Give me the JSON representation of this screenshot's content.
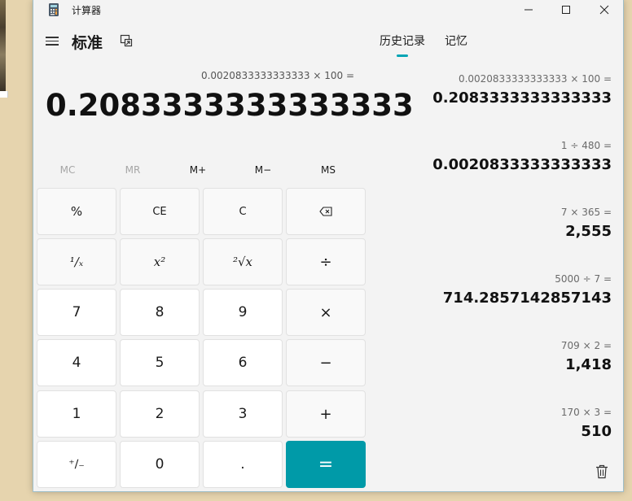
{
  "window": {
    "title": "计算器"
  },
  "header": {
    "mode": "标准"
  },
  "tabs": [
    {
      "label": "历史记录"
    },
    {
      "label": "记忆"
    }
  ],
  "display": {
    "expression": "0.0020833333333333 × 100 =",
    "result": "0.2083333333333333"
  },
  "memory": [
    "MC",
    "MR",
    "M+",
    "M−",
    "MS"
  ],
  "keys": {
    "percent": "%",
    "ce": "CE",
    "c": "C",
    "backspace": "⌫",
    "reciprocal": "¹∕ₓ",
    "square": "x²",
    "sqrt": "²√x",
    "divide": "÷",
    "seven": "7",
    "eight": "8",
    "nine": "9",
    "multiply": "×",
    "four": "4",
    "five": "5",
    "six": "6",
    "minus": "−",
    "one": "1",
    "two": "2",
    "three": "3",
    "plus": "+",
    "negate": "⁺∕₋",
    "zero": "0",
    "decimal": ".",
    "equals": "="
  },
  "history": [
    {
      "expression": "0.0020833333333333   ×   100 =",
      "result": "0.2083333333333333"
    },
    {
      "expression": "1   ÷   480 =",
      "result": "0.0020833333333333"
    },
    {
      "expression": "7   ×   365 =",
      "result": "2,555"
    },
    {
      "expression": "5000   ÷   7 =",
      "result": "714.2857142857143"
    },
    {
      "expression": "709   ×   2 =",
      "result": "1,418"
    },
    {
      "expression": "170   ×   3 =",
      "result": "510"
    }
  ],
  "colors": {
    "accent": "#009aa8"
  }
}
